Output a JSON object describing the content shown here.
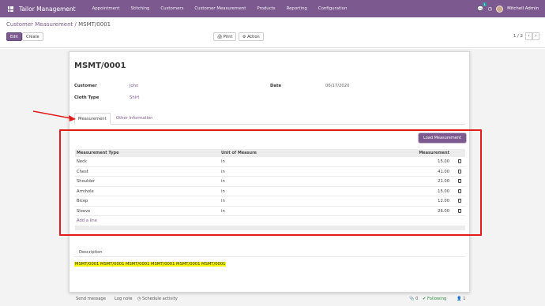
{
  "navbar": {
    "app_name": "Tailor Management",
    "menu": [
      "Appointment",
      "Stitching",
      "Customers",
      "Customer Measurement",
      "Products",
      "Reporting",
      "Configuration"
    ],
    "chat_badge": "1",
    "user_name": "Mitchell Admin"
  },
  "control": {
    "breadcrumb_parent": "Customer Measurement",
    "breadcrumb_sep": "/",
    "breadcrumb_current": "MSMT/0001",
    "edit_label": "Edit",
    "create_label": "Create",
    "print_label": "🖨 Print",
    "action_label": "⚙ Action",
    "pager": "1 / 2",
    "prev": "‹",
    "next": "›"
  },
  "record": {
    "title": "MSMT/0001",
    "customer_label": "Customer",
    "customer_value": "John",
    "cloth_type_label": "Cloth Type",
    "cloth_type_value": "Shirt",
    "date_label": "Date",
    "date_value": "06/17/2020"
  },
  "tabs": [
    "Measurement",
    "Other Information"
  ],
  "load_button": "Load Measurement",
  "table": {
    "headers": [
      "Measurement Type",
      "Unit of Measure",
      "Measurement"
    ],
    "rows": [
      {
        "type": "Neck",
        "unit": "in",
        "value": "15.00"
      },
      {
        "type": "Chest",
        "unit": "in",
        "value": "41.00"
      },
      {
        "type": "Shoulder",
        "unit": "in",
        "value": "21.00"
      },
      {
        "type": "Armhole",
        "unit": "in",
        "value": "15.00"
      },
      {
        "type": "Bicep",
        "unit": "in",
        "value": "12.00"
      },
      {
        "type": "Sleeve",
        "unit": "in",
        "value": "26.00"
      }
    ],
    "add_line": "Add a line"
  },
  "description": {
    "tab": "Description",
    "text": "MSMT/0001 MSMT/0001 MSMT/0001 MSMT/0001 MSMT/0001 MSMT/0001"
  },
  "chatter": {
    "send_message": "Send message",
    "log_note": "Log note",
    "schedule": "◷ Schedule activity",
    "attachments": "📎 0",
    "following": "✔ Following",
    "followers": "👤 1"
  },
  "colors": {
    "brand": "#7c5a8f",
    "annotation": "#e31b1b",
    "highlight": "#f6f400"
  }
}
